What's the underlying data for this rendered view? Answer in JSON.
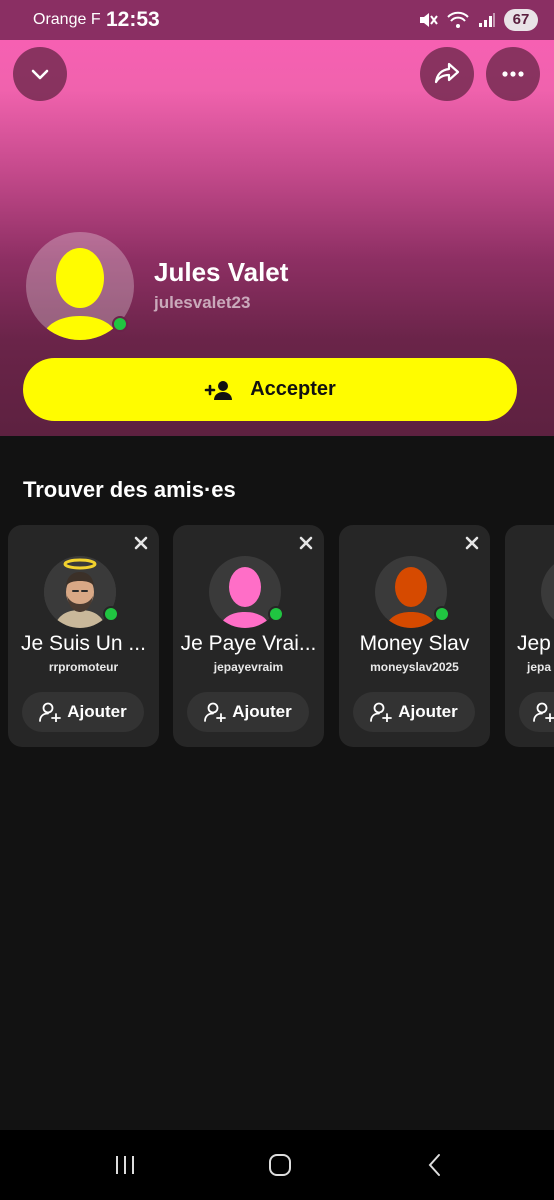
{
  "status_bar": {
    "carrier": "Orange F",
    "time": "12:53",
    "battery": "67"
  },
  "profile": {
    "name": "Jules Valet",
    "username": "julesvalet23",
    "online": true,
    "avatar_color": "#fffc00"
  },
  "actions": {
    "accept_label": "Accepter"
  },
  "suggestions": {
    "title": "Trouver des amis·es",
    "add_label": "Ajouter",
    "cards": [
      {
        "name": "Je Suis Un Promoteur",
        "display": "Je Suis Un ...",
        "username": "rrpromoteur",
        "avatar": "bitmoji-halo"
      },
      {
        "name": "Je Paye Vraiment",
        "display": "Je Paye Vrai...",
        "username": "jepayevraim",
        "avatar_color": "#ff6ec7"
      },
      {
        "name": "Money Slav",
        "display": "Money Slav",
        "username": "moneyslav2025",
        "avatar_color": "#d64a00"
      },
      {
        "name": "Jep",
        "display": "Jep",
        "username": "jepa",
        "avatar_color": "#555555"
      }
    ]
  },
  "colors": {
    "accent_yellow": "#fffc00",
    "online_green": "#20c541",
    "hero_top": "#fb5fb7",
    "hero_bottom": "#5d2140"
  }
}
